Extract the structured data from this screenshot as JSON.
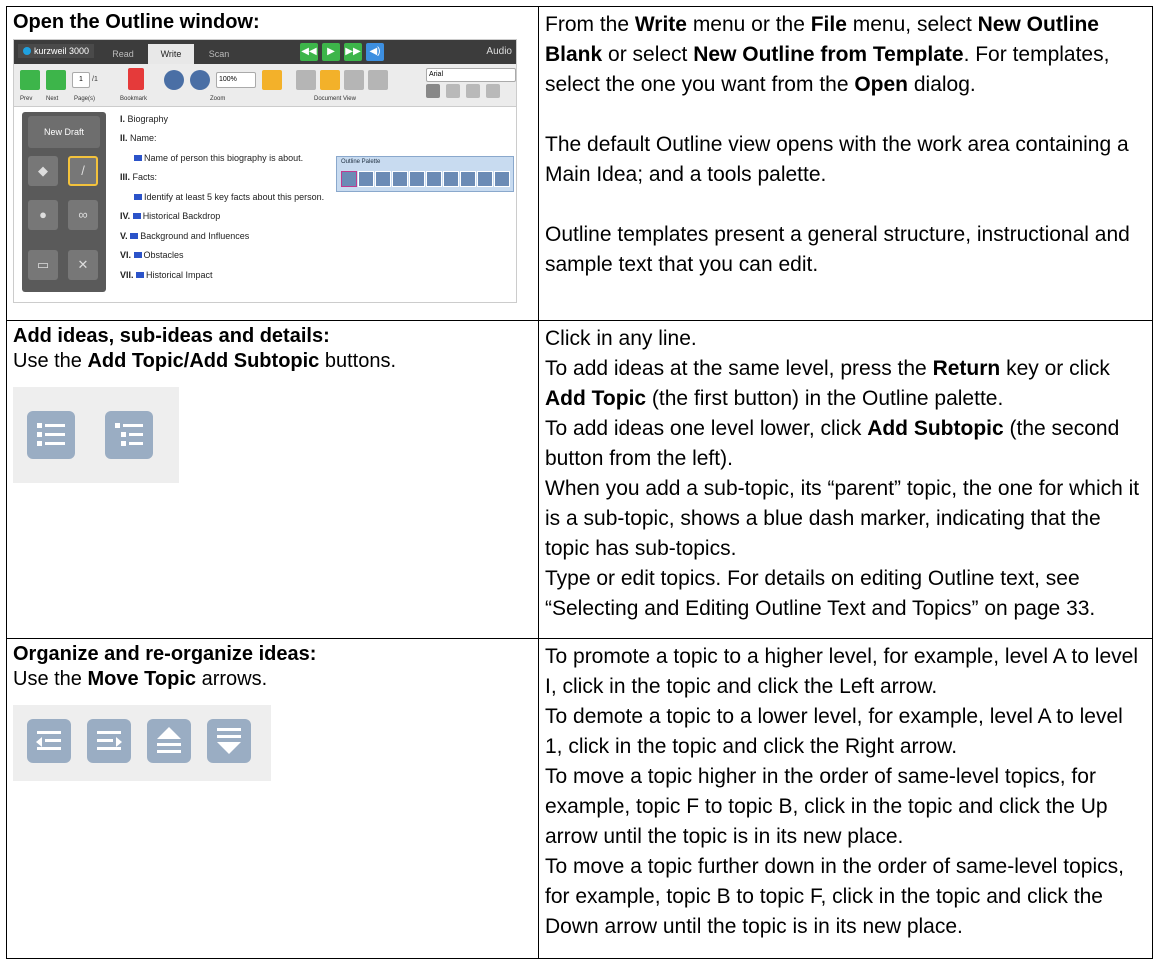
{
  "row1": {
    "heading": "Open the Outline window:",
    "screenshot": {
      "logo": "kurzweil 3000",
      "tabs": [
        "Read",
        "Write",
        "Scan"
      ],
      "audio": "Audio",
      "page_value": "1",
      "page_total": "/1",
      "zoom_value": "100%",
      "font_value": "Arial",
      "labels": {
        "prev": "Prev",
        "next": "Next",
        "pages": "Page(s)",
        "bookmark": "Bookmark",
        "zoom": "Zoom",
        "docview": "Document View"
      },
      "new_draft": "New Draft",
      "outline": [
        {
          "num": "I.",
          "text": "Biography",
          "marker": false,
          "indent": false
        },
        {
          "num": "II.",
          "text": "Name:",
          "marker": false,
          "indent": false
        },
        {
          "num": "",
          "text": "Name of person this biography is about.",
          "marker": true,
          "indent": true
        },
        {
          "num": "III.",
          "text": "Facts:",
          "marker": false,
          "indent": false
        },
        {
          "num": "",
          "text": "Identify at least 5 key facts about this person.",
          "marker": true,
          "indent": true
        },
        {
          "num": "IV.",
          "text": "Historical Backdrop",
          "marker": true,
          "indent": false
        },
        {
          "num": "V.",
          "text": "Background and Influences",
          "marker": true,
          "indent": false
        },
        {
          "num": "VI.",
          "text": "Obstacles",
          "marker": true,
          "indent": false
        },
        {
          "num": "VII.",
          "text": "Historical Impact",
          "marker": true,
          "indent": false
        }
      ],
      "palette_title": "Outline Palette"
    },
    "p1": {
      "a": "From the ",
      "b": "Write",
      "c": " menu or the ",
      "d": "File",
      "e": " menu, select ",
      "f": "New Outline Blank",
      "g": " or select ",
      "h": "New Outline from Template",
      "i": ". For templates, select the one you want from the ",
      "j": "Open",
      "k": " dialog."
    },
    "p2": "The default Outline view opens with the work area containing a Main Idea; and a tools palette.",
    "p3": "Outline templates present a general structure, instructional and sample text that you can edit."
  },
  "row2": {
    "heading": "Add ideas, sub-ideas and details:",
    "use_a": "Use the ",
    "use_b": "Add Topic/Add Subtopic",
    "use_c": " buttons.",
    "icons": [
      "add-topic-icon",
      "add-subtopic-icon"
    ],
    "l1": "Click in any line.",
    "l2a": "To add ideas at the same level, press the ",
    "l2b": "Return",
    "l2c": " key or click ",
    "l2d": "Add Topic",
    "l2e": " (the first button) in the Outline palette.",
    "l3a": "To add ideas one level lower, click ",
    "l3b": "Add Subtopic",
    "l3c": " (the second button from the left).",
    "l4": "When you add a sub-topic, its “parent” topic, the one for which it is a sub-topic, shows a blue dash marker, indicating that the topic has sub-topics.",
    "l5": "Type or edit topics. For details on editing Outline text, see “Selecting and Editing Outline Text and Topics” on page 33."
  },
  "row3": {
    "heading": "Organize and re-organize ideas:",
    "use_a": "Use the ",
    "use_b": "Move Topic",
    "use_c": " arrows.",
    "icons": [
      "move-left-icon",
      "move-right-icon",
      "move-up-icon",
      "move-down-icon"
    ],
    "l1": "To promote a topic to a higher level, for example, level A to level I, click in the topic and click the Left arrow.",
    "l2": "To demote a topic to a lower level, for example, level A to level 1, click in the topic and click the Right arrow.",
    "l3": "To move a topic higher in the order of same-level topics, for example, topic F to topic B, click in the topic and click the Up arrow until the topic is in its new place.",
    "l4": "To move a topic further down in the order of same-level topics, for example, topic B to topic F, click in the topic and click the Down arrow until the topic is in its new place."
  },
  "colors": {
    "icon_bg": "#9aadc3",
    "strip_bg": "#eeeeee",
    "marker_blue": "#2b53c9",
    "play_green": "#3db54a"
  }
}
